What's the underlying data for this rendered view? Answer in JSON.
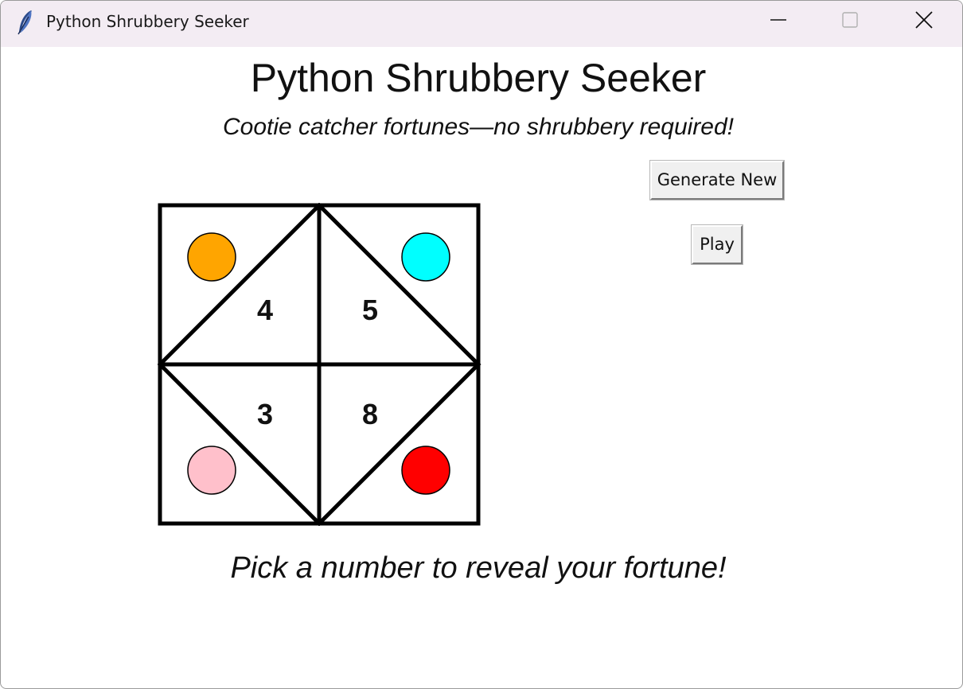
{
  "window": {
    "title": "Python Shrubbery Seeker",
    "controls": [
      "minimize-icon",
      "maximize-icon",
      "close-icon"
    ]
  },
  "header": {
    "title": "Python Shrubbery Seeker",
    "subtitle": "Cootie catcher fortunes—no shrubbery required!"
  },
  "buttons": {
    "generate_label": "Generate New",
    "play_label": "Play"
  },
  "cootie_catcher": {
    "numbers": {
      "top_left": "4",
      "top_right": "5",
      "bottom_left": "3",
      "bottom_right": "8"
    },
    "corner_colors": {
      "top_left": "#FFA500",
      "top_right": "#00FFFF",
      "bottom_left": "#FFC0CB",
      "bottom_right": "#FF0000"
    }
  },
  "instructions": "Pick a number to reveal your fortune!"
}
